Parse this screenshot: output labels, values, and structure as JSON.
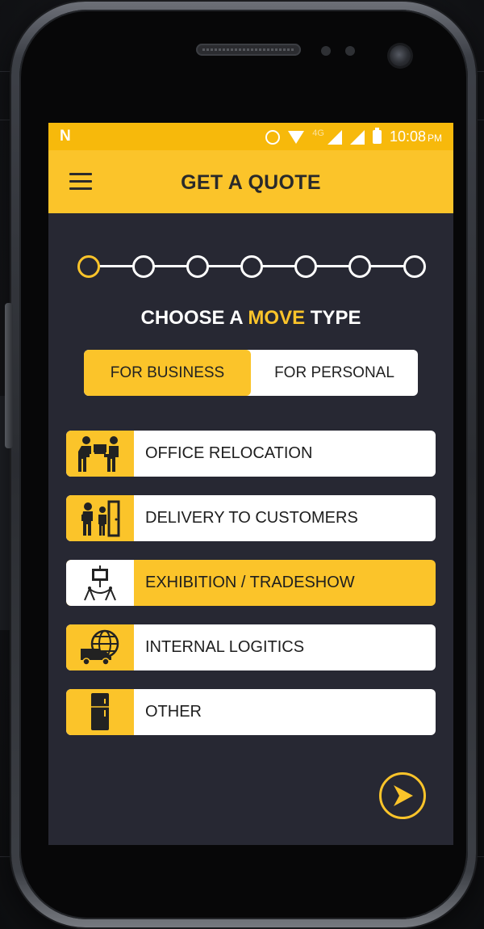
{
  "status_bar": {
    "carrier_glyph": "N",
    "network": "4G",
    "time": "10:08",
    "ampm": "PM"
  },
  "app_bar": {
    "title": "GET A QUOTE",
    "menu_icon": "hamburger-menu-icon"
  },
  "stepper": {
    "total_steps": 7,
    "current_step": 1
  },
  "heading": {
    "prefix": "CHOOSE A ",
    "highlight": "MOVE",
    "suffix": " TYPE"
  },
  "toggle": {
    "options": [
      "FOR BUSINESS",
      "FOR PERSONAL"
    ],
    "selected": "FOR BUSINESS"
  },
  "move_types": [
    {
      "label": "OFFICE RELOCATION",
      "icon": "movers-carrying-box-icon",
      "selected": false
    },
    {
      "label": "DELIVERY TO CUSTOMERS",
      "icon": "delivery-person-door-icon",
      "selected": false
    },
    {
      "label": "EXHIBITION / TRADESHOW",
      "icon": "exhibition-stand-icon",
      "selected": true
    },
    {
      "label": "INTERNAL LOGITICS",
      "icon": "globe-truck-icon",
      "selected": false
    },
    {
      "label": "OTHER",
      "icon": "cabinet-icon",
      "selected": false
    }
  ],
  "next_button": {
    "icon": "arrow-right-icon"
  },
  "colors": {
    "accent": "#fbc42a",
    "status_bar": "#f7b90b",
    "screen_bg": "#272833",
    "card_bg": "#ffffff"
  }
}
